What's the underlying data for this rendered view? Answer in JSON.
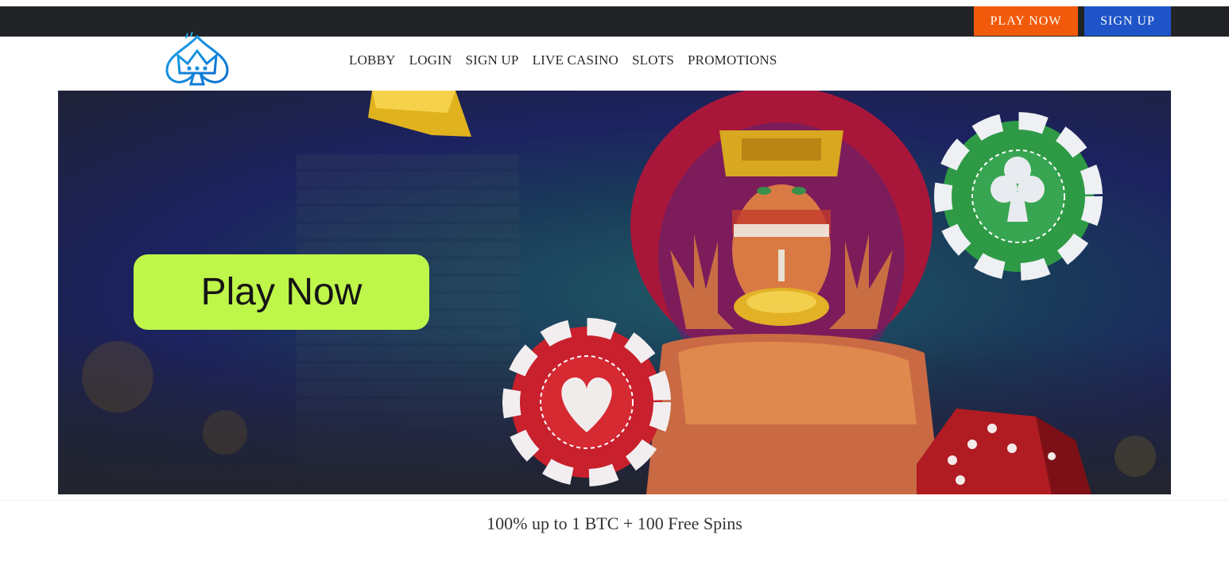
{
  "topbar": {
    "play_now_label": "PLAY NOW",
    "sign_up_label": "SIGN UP",
    "play_color": "#f15a0a",
    "sign_color": "#1f54c9"
  },
  "header": {
    "logo_icon": "spade-crown-icon",
    "nav": [
      {
        "label": "LOBBY"
      },
      {
        "label": "LOGIN"
      },
      {
        "label": "SIGN UP"
      },
      {
        "label": "LIVE CASINO"
      },
      {
        "label": "SLOTS"
      },
      {
        "label": "PROMOTIONS"
      }
    ]
  },
  "banner": {
    "cta_label": "Play Now",
    "cta_color": "#bff64a"
  },
  "promo": {
    "text": "100% up to 1 BTC + 100 Free Spins"
  }
}
